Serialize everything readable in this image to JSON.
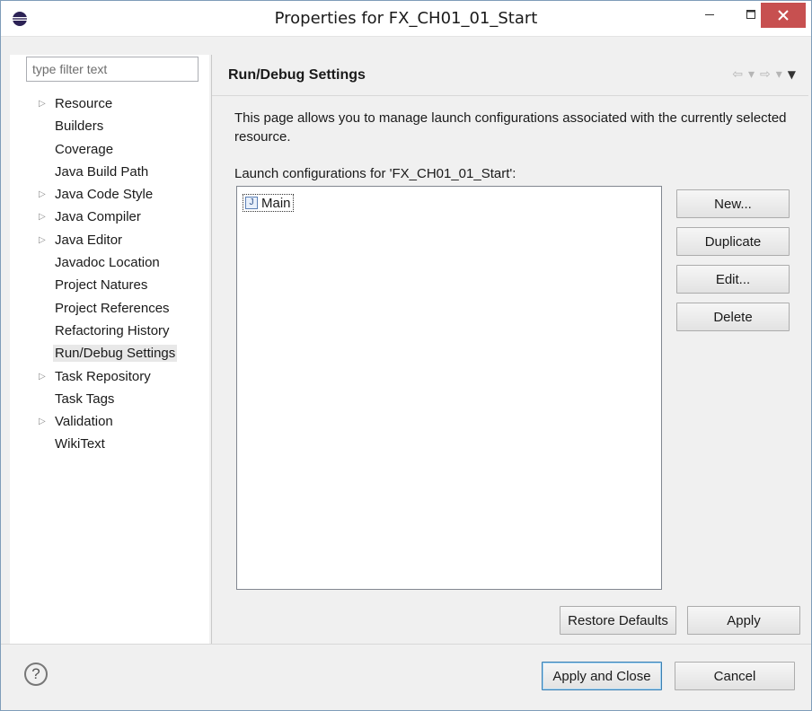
{
  "window": {
    "title": "Properties for FX_CH01_01_Start",
    "minimize_glyph": "–",
    "maximize_glyph": "☐",
    "close_glyph": "✕"
  },
  "filter": {
    "placeholder": "type filter text"
  },
  "tree": {
    "items": [
      {
        "label": "Resource",
        "expandable": true
      },
      {
        "label": "Builders",
        "expandable": false
      },
      {
        "label": "Coverage",
        "expandable": false
      },
      {
        "label": "Java Build Path",
        "expandable": false
      },
      {
        "label": "Java Code Style",
        "expandable": true
      },
      {
        "label": "Java Compiler",
        "expandable": true
      },
      {
        "label": "Java Editor",
        "expandable": true
      },
      {
        "label": "Javadoc Location",
        "expandable": false
      },
      {
        "label": "Project Natures",
        "expandable": false
      },
      {
        "label": "Project References",
        "expandable": false
      },
      {
        "label": "Refactoring History",
        "expandable": false
      },
      {
        "label": "Run/Debug Settings",
        "expandable": false,
        "selected": true
      },
      {
        "label": "Task Repository",
        "expandable": true
      },
      {
        "label": "Task Tags",
        "expandable": false
      },
      {
        "label": "Validation",
        "expandable": true
      },
      {
        "label": "WikiText",
        "expandable": false
      }
    ]
  },
  "page": {
    "title": "Run/Debug Settings",
    "description": "This page allows you to manage launch configurations associated with the currently selected resource.",
    "list_label": "Launch configurations for 'FX_CH01_01_Start':",
    "configurations": [
      {
        "label": "Main",
        "icon": "java-app-icon"
      }
    ]
  },
  "buttons": {
    "new": "New...",
    "duplicate": "Duplicate",
    "edit": "Edit...",
    "delete": "Delete",
    "restore_defaults": "Restore Defaults",
    "apply": "Apply",
    "apply_and_close": "Apply and Close",
    "cancel": "Cancel"
  },
  "colors": {
    "close_button": "#c75050",
    "default_button_border": "#3c7fb1"
  }
}
